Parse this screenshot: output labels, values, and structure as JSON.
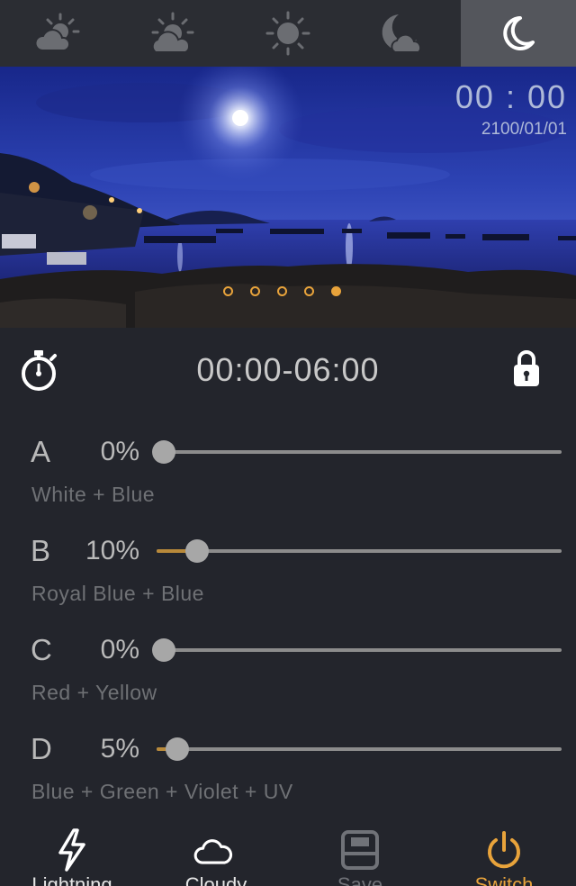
{
  "mode_tabs": [
    {
      "name": "cloudy-sun-icon",
      "active": false
    },
    {
      "name": "sunrise-icon",
      "active": false
    },
    {
      "name": "sun-icon",
      "active": false
    },
    {
      "name": "moon-cloud-icon",
      "active": false
    },
    {
      "name": "moon-icon",
      "active": true
    }
  ],
  "hero": {
    "time": "00 : 00",
    "date": "2100/01/01",
    "page_dots": {
      "count": 5,
      "active_index": 4
    }
  },
  "period": {
    "range": "00:00-06:00",
    "left_icon": "stopwatch-icon",
    "right_icon": "lock-icon"
  },
  "channels": [
    {
      "letter": "A",
      "value_label": "0%",
      "value": 0,
      "description": "White  +  Blue"
    },
    {
      "letter": "B",
      "value_label": "10%",
      "value": 10,
      "description": "Royal Blue + Blue"
    },
    {
      "letter": "C",
      "value_label": "0%",
      "value": 0,
      "description": "Red + Yellow"
    },
    {
      "letter": "D",
      "value_label": "5%",
      "value": 5,
      "description": "Blue + Green + Violet + UV"
    }
  ],
  "bottom_nav": [
    {
      "label": "Lightning",
      "icon": "lightning-icon"
    },
    {
      "label": "Cloudy",
      "icon": "cloud-icon"
    },
    {
      "label": "Save",
      "icon": "save-icon"
    },
    {
      "label": "Switch",
      "icon": "power-icon"
    }
  ],
  "colors": {
    "accent": "#e8a33b",
    "background": "#23252c",
    "active_tab": "#54565c"
  }
}
